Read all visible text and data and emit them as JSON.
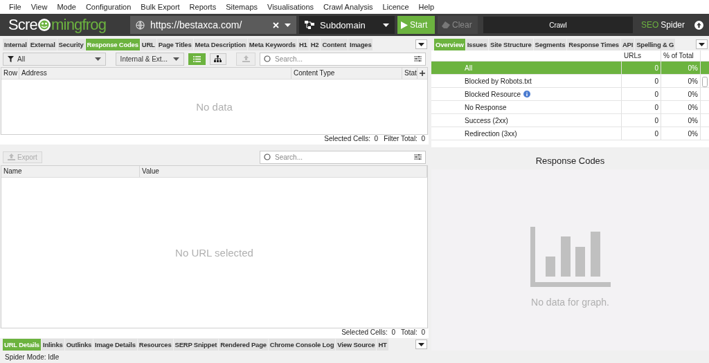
{
  "menu": [
    "File",
    "View",
    "Mode",
    "Configuration",
    "Bulk Export",
    "Reports",
    "Sitemaps",
    "Visualisations",
    "Crawl Analysis",
    "Licence",
    "Help"
  ],
  "header": {
    "logo_start": "Scre",
    "logo_end": "mingfrog",
    "url": "https://bestaxca.com/",
    "scope": "Subdomain",
    "start": "Start",
    "clear": "Clear",
    "clear_disabled": true,
    "crawl": {
      "label": "Crawl",
      "level": 0
    },
    "brand_seo": "SEO",
    "brand_spider": "Spider"
  },
  "left": {
    "tabs": [
      {
        "label": "Internal",
        "selected": false
      },
      {
        "label": "External",
        "selected": false
      },
      {
        "label": "Security",
        "selected": false
      },
      {
        "label": "Response Codes",
        "selected": true
      },
      {
        "label": "URL",
        "selected": false
      },
      {
        "label": "Page Titles",
        "selected": false
      },
      {
        "label": "Meta Description",
        "selected": false
      },
      {
        "label": "Meta Keywords",
        "selected": false
      },
      {
        "label": "H1",
        "selected": false
      },
      {
        "label": "H2",
        "selected": false
      },
      {
        "label": "Content",
        "selected": false
      },
      {
        "label": "Images",
        "selected": false
      }
    ],
    "filter": "All",
    "scope_filter": "Internal & Ext...",
    "view_toggle": [
      {
        "kind": "list",
        "selected": true
      },
      {
        "kind": "tree",
        "selected": false
      }
    ],
    "search_placeholder": "Search...",
    "columns": [
      "Row",
      "Address",
      "Content Type",
      "Stat"
    ],
    "empty": "No data",
    "status": [
      "Selected Cells:  0",
      "Filter Total:  0"
    ]
  },
  "details": {
    "export": "Export",
    "export_disabled": true,
    "search_placeholder": "Search...",
    "columns": [
      "Name",
      "Value"
    ],
    "empty": "No URL selected",
    "status": [
      "Selected Cells:  0",
      "Total:  0"
    ],
    "tabs": [
      {
        "label": "URL Details",
        "selected": true
      },
      {
        "label": "Inlinks",
        "selected": false
      },
      {
        "label": "Outlinks",
        "selected": false
      },
      {
        "label": "Image Details",
        "selected": false
      },
      {
        "label": "Resources",
        "selected": false
      },
      {
        "label": "SERP Snippet",
        "selected": false
      },
      {
        "label": "Rendered Page",
        "selected": false
      },
      {
        "label": "Chrome Console Log",
        "selected": false
      },
      {
        "label": "View Source",
        "selected": false
      },
      {
        "label": "HT",
        "selected": false
      }
    ]
  },
  "right": {
    "tabs": [
      {
        "label": "Overview",
        "selected": true
      },
      {
        "label": "Issues",
        "selected": false
      },
      {
        "label": "Site Structure",
        "selected": false
      },
      {
        "label": "Segments",
        "selected": false
      },
      {
        "label": "Response Times",
        "selected": false
      },
      {
        "label": "API",
        "selected": false
      },
      {
        "label": "Spelling & G",
        "selected": false
      }
    ],
    "columns": [
      "URLs",
      "% of Total"
    ],
    "rows": [
      {
        "label": "All",
        "urls": "0",
        "pct": "0%",
        "selected": true,
        "info": false
      },
      {
        "label": "Blocked by Robots.txt",
        "urls": "0",
        "pct": "0%",
        "selected": false,
        "info": false
      },
      {
        "label": "Blocked Resource",
        "urls": "0",
        "pct": "0%",
        "selected": false,
        "info": true
      },
      {
        "label": "No Response",
        "urls": "0",
        "pct": "0%",
        "selected": false,
        "info": false
      },
      {
        "label": "Success (2xx)",
        "urls": "0",
        "pct": "0%",
        "selected": false,
        "info": false
      },
      {
        "label": "Redirection (3xx)",
        "urls": "0",
        "pct": "0%",
        "selected": false,
        "info": false
      }
    ],
    "chart_title": "Response Codes",
    "chart_empty": "No data for graph."
  },
  "status_bar": "Spider Mode: Idle"
}
